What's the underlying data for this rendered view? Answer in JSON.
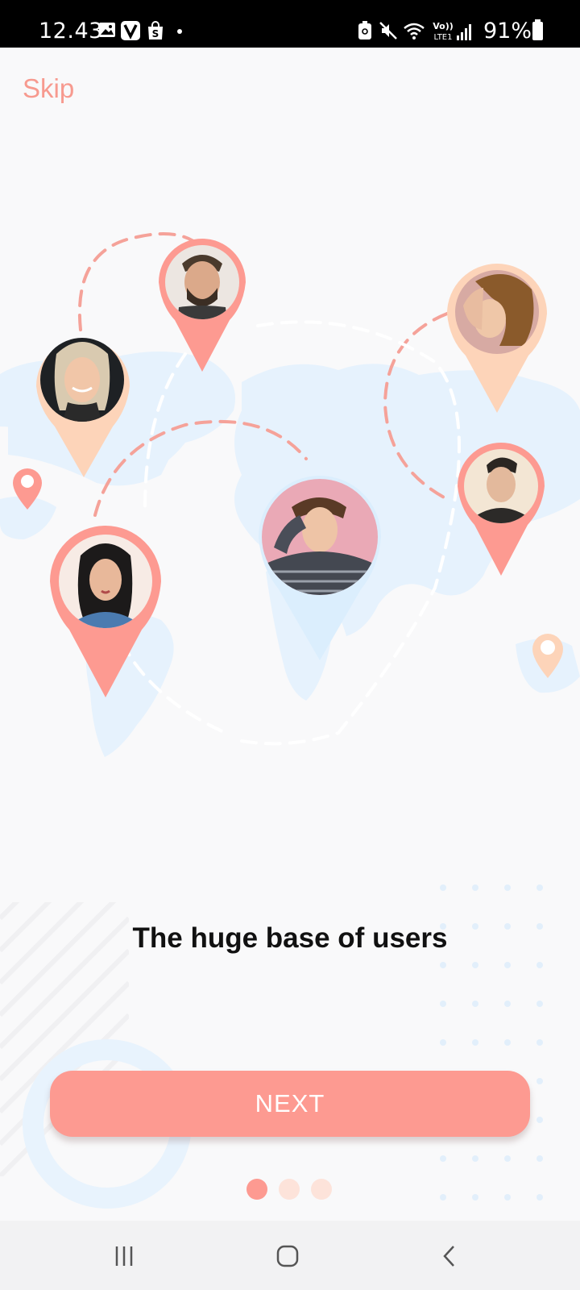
{
  "status_bar": {
    "time": "12.43",
    "battery": "91%",
    "icons": [
      "gallery-icon",
      "v-app-icon",
      "shop-icon",
      "dot-icon",
      "battery-saver-icon",
      "mute-icon",
      "wifi-icon",
      "volte-icon",
      "signal-icon",
      "battery-icon"
    ],
    "volte_label": "Vo)) LTE1"
  },
  "onboarding": {
    "skip_label": "Skip",
    "headline": "The huge base of users",
    "next_label": "NEXT",
    "page_count": 3,
    "current_page": 1
  },
  "colors": {
    "accent": "#fd9a91",
    "accent_light": "#fde3da",
    "pin_peach": "#fdd4b9",
    "map_blue": "#e6f2fd",
    "pin_blue": "#dbeefd"
  },
  "nav_bar": {
    "icons": [
      "recent-apps-icon",
      "home-icon",
      "back-icon"
    ]
  }
}
